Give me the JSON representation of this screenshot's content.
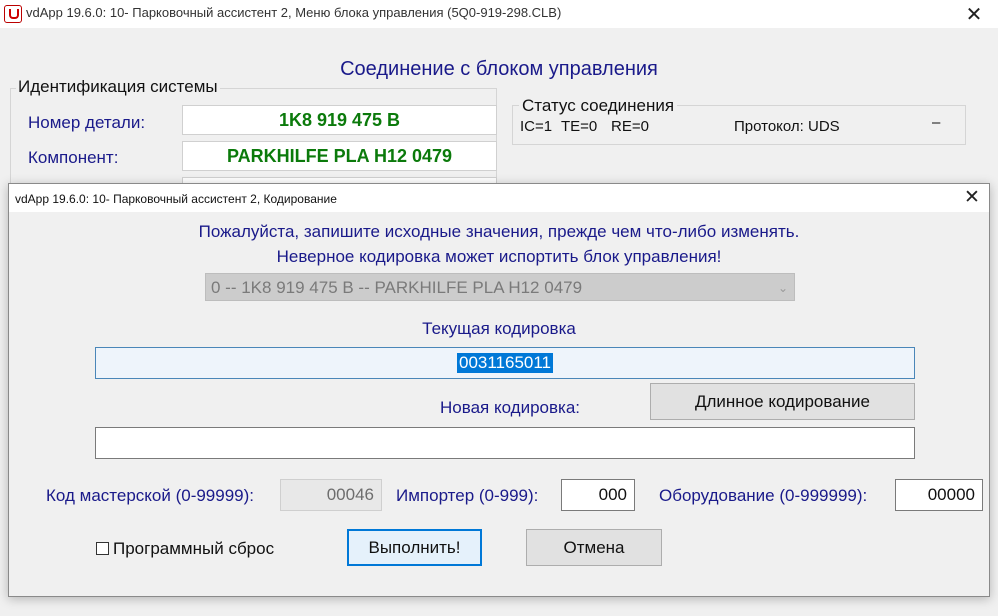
{
  "main_window": {
    "title": "vdApp 19.6.0: 10- Парковочный ассистент 2,  Меню блока управления (5Q0-919-298.CLB)",
    "close_glyph": "✕",
    "header": "Соединение с блоком управления",
    "identification": {
      "group_title": "Идентификация системы",
      "part_number_label": "Номер детали:",
      "part_number_value": "1K8 919 475 B",
      "component_label": "Компонент:",
      "component_value": "PARKHILFE PLA H12 0479"
    },
    "connection_status": {
      "group_title": "Статус соединения",
      "ic": "IC=1",
      "te": "TE=0",
      "re": "RE=0",
      "protocol": "Протокол: UDS",
      "dash": "–"
    }
  },
  "dialog": {
    "title": "vdApp 19.6.0: 10- Парковочный ассистент 2,  Кодирование",
    "close_glyph": "✕",
    "warning_line1": "Пожалуйста, запишите исходные значения, прежде чем что-либо изменять.",
    "warning_line2": "Неверное кодировка может испортить блок управления!",
    "ecu_select_value": "0 -- 1K8 919 475 B -- PARKHILFE PLA H12 0479",
    "current_coding_label": "Текущая кодировка",
    "current_coding_value": "0031165011",
    "new_coding_label": "Новая кодировка:",
    "new_coding_value": "",
    "long_coding_button": "Длинное кодирование",
    "workshop_code_label": "Код мастерской (0-99999):",
    "workshop_code_value": "00046",
    "importer_label": "Импортер (0-999):",
    "importer_value": "000",
    "equipment_label": "Оборудование (0-999999):",
    "equipment_value": "00000",
    "software_reset_label": "Программный сброс",
    "software_reset_checked": false,
    "execute_button": "Выполнить!",
    "cancel_button": "Отмена"
  },
  "colors": {
    "label_blue": "#1a1a8a",
    "value_green": "#0b7a0b",
    "selection_blue": "#0078d7"
  }
}
